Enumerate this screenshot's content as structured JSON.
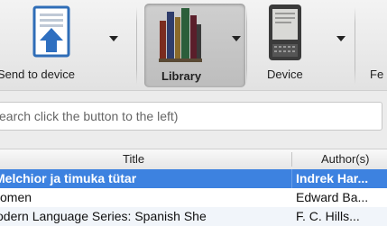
{
  "toolbar": {
    "send_label": "Send to device",
    "library_label": "Library",
    "device_label": "Device",
    "next_label_partial": "Fe"
  },
  "search": {
    "placeholder_text": "earch click the button to the left)"
  },
  "table": {
    "headers": {
      "title": "Title",
      "author": "Author(s)"
    },
    "rows": [
      {
        "title": "Melchior ja timuka tütar",
        "author": "Indrek Har...",
        "state": "selected"
      },
      {
        "title": "omen",
        "author": "Edward Ba...",
        "state": "normal"
      },
      {
        "title": "odern Language Series: Spanish She",
        "author": "F. C. Hills...",
        "state": "normal"
      }
    ]
  },
  "colors": {
    "selection": "#3d82e0",
    "toolbar_bg": "#e9e9e9",
    "library_pressed": "#c9c9c9"
  },
  "icons": {
    "send": "send-to-device-icon",
    "library": "library-books-icon",
    "device": "ebook-reader-icon"
  }
}
